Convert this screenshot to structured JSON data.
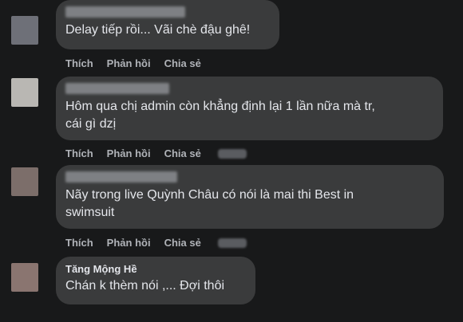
{
  "actions": {
    "like": "Thích",
    "reply": "Phản hồi",
    "share": "Chia sẻ"
  },
  "comments": [
    {
      "author": "",
      "text": "Delay tiếp rồi... Vãi chè đậu ghê!",
      "avatar_color": "#6e7078"
    },
    {
      "author": "",
      "text": "Hôm qua chị admin còn khẳng định lại 1 lần nữa mà tr,\ncái gì dzị",
      "avatar_color": "#b9b7b3"
    },
    {
      "author": "",
      "text": "Nãy trong live Quỳnh Châu có nói là mai thi Best in\nswimsuit",
      "avatar_color": "#7c6e6a"
    },
    {
      "author": "Tăng Mộng Hề",
      "text": "Chán k thèm nói ,... Đợi thôi",
      "avatar_color": "#8a7570"
    }
  ],
  "colors": {
    "background": "#18191a",
    "bubble": "#3a3b3c",
    "text": "#e4e6eb",
    "secondary_text": "#b0b3b8"
  }
}
